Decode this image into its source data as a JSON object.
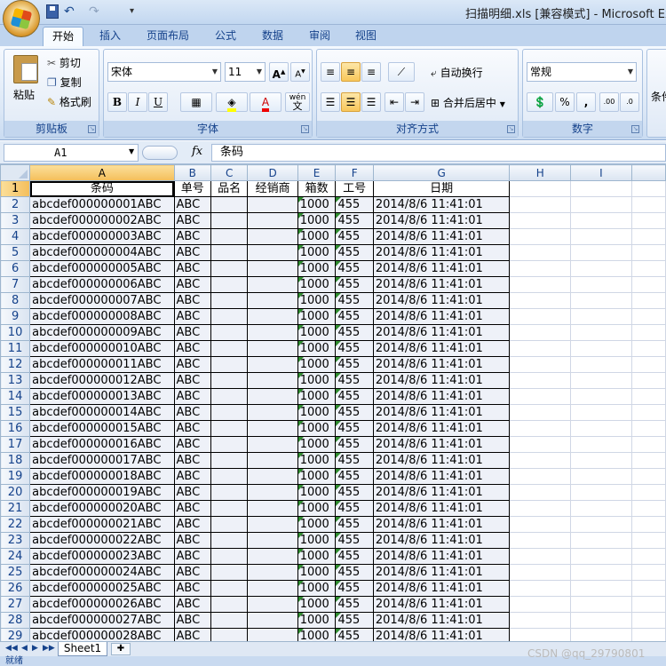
{
  "window": {
    "title": "扫描明细.xls [兼容模式] - Microsoft Exce"
  },
  "quick_access": {
    "undo": "↶",
    "redo": "↷",
    "more": "▾"
  },
  "ribbon": {
    "tabs": [
      "开始",
      "插入",
      "页面布局",
      "公式",
      "数据",
      "审阅",
      "视图"
    ],
    "clipboard": {
      "paste": "粘贴",
      "cut": "剪切",
      "copy": "复制",
      "format_painter": "格式刷",
      "label": "剪贴板"
    },
    "font": {
      "name": "宋体",
      "size": "11",
      "grow": "A",
      "shrink": "A",
      "bold": "B",
      "italic": "I",
      "underline": "U",
      "font_color": "A",
      "label": "字体",
      "wen": "wén",
      "wen_char": "文"
    },
    "alignment": {
      "wrap_text": "自动换行",
      "merge_center": "合并后居中",
      "label": "对齐方式"
    },
    "number": {
      "format": "常规",
      "percent": "%",
      "comma": ",",
      "label": "数字"
    },
    "styles": {
      "label": "条件"
    }
  },
  "formula_bar": {
    "name_box": "A1",
    "fx": "fx",
    "content": "条码"
  },
  "sheet": {
    "columns": [
      "A",
      "B",
      "C",
      "D",
      "E",
      "F",
      "G",
      "H",
      "I"
    ],
    "header_row": [
      "条码",
      "单号",
      "品名",
      "经销商",
      "箱数",
      "工号",
      "日期"
    ],
    "rows": [
      [
        "abcdef000000001ABC",
        "ABC",
        "",
        "",
        "1000",
        "455",
        "2014/8/6 11:41:01"
      ],
      [
        "abcdef000000002ABC",
        "ABC",
        "",
        "",
        "1000",
        "455",
        "2014/8/6 11:41:01"
      ],
      [
        "abcdef000000003ABC",
        "ABC",
        "",
        "",
        "1000",
        "455",
        "2014/8/6 11:41:01"
      ],
      [
        "abcdef000000004ABC",
        "ABC",
        "",
        "",
        "1000",
        "455",
        "2014/8/6 11:41:01"
      ],
      [
        "abcdef000000005ABC",
        "ABC",
        "",
        "",
        "1000",
        "455",
        "2014/8/6 11:41:01"
      ],
      [
        "abcdef000000006ABC",
        "ABC",
        "",
        "",
        "1000",
        "455",
        "2014/8/6 11:41:01"
      ],
      [
        "abcdef000000007ABC",
        "ABC",
        "",
        "",
        "1000",
        "455",
        "2014/8/6 11:41:01"
      ],
      [
        "abcdef000000008ABC",
        "ABC",
        "",
        "",
        "1000",
        "455",
        "2014/8/6 11:41:01"
      ],
      [
        "abcdef000000009ABC",
        "ABC",
        "",
        "",
        "1000",
        "455",
        "2014/8/6 11:41:01"
      ],
      [
        "abcdef000000010ABC",
        "ABC",
        "",
        "",
        "1000",
        "455",
        "2014/8/6 11:41:01"
      ],
      [
        "abcdef000000011ABC",
        "ABC",
        "",
        "",
        "1000",
        "455",
        "2014/8/6 11:41:01"
      ],
      [
        "abcdef000000012ABC",
        "ABC",
        "",
        "",
        "1000",
        "455",
        "2014/8/6 11:41:01"
      ],
      [
        "abcdef000000013ABC",
        "ABC",
        "",
        "",
        "1000",
        "455",
        "2014/8/6 11:41:01"
      ],
      [
        "abcdef000000014ABC",
        "ABC",
        "",
        "",
        "1000",
        "455",
        "2014/8/6 11:41:01"
      ],
      [
        "abcdef000000015ABC",
        "ABC",
        "",
        "",
        "1000",
        "455",
        "2014/8/6 11:41:01"
      ],
      [
        "abcdef000000016ABC",
        "ABC",
        "",
        "",
        "1000",
        "455",
        "2014/8/6 11:41:01"
      ],
      [
        "abcdef000000017ABC",
        "ABC",
        "",
        "",
        "1000",
        "455",
        "2014/8/6 11:41:01"
      ],
      [
        "abcdef000000018ABC",
        "ABC",
        "",
        "",
        "1000",
        "455",
        "2014/8/6 11:41:01"
      ],
      [
        "abcdef000000019ABC",
        "ABC",
        "",
        "",
        "1000",
        "455",
        "2014/8/6 11:41:01"
      ],
      [
        "abcdef000000020ABC",
        "ABC",
        "",
        "",
        "1000",
        "455",
        "2014/8/6 11:41:01"
      ],
      [
        "abcdef000000021ABC",
        "ABC",
        "",
        "",
        "1000",
        "455",
        "2014/8/6 11:41:01"
      ],
      [
        "abcdef000000022ABC",
        "ABC",
        "",
        "",
        "1000",
        "455",
        "2014/8/6 11:41:01"
      ],
      [
        "abcdef000000023ABC",
        "ABC",
        "",
        "",
        "1000",
        "455",
        "2014/8/6 11:41:01"
      ],
      [
        "abcdef000000024ABC",
        "ABC",
        "",
        "",
        "1000",
        "455",
        "2014/8/6 11:41:01"
      ],
      [
        "abcdef000000025ABC",
        "ABC",
        "",
        "",
        "1000",
        "455",
        "2014/8/6 11:41:01"
      ],
      [
        "abcdef000000026ABC",
        "ABC",
        "",
        "",
        "1000",
        "455",
        "2014/8/6 11:41:01"
      ],
      [
        "abcdef000000027ABC",
        "ABC",
        "",
        "",
        "1000",
        "455",
        "2014/8/6 11:41:01"
      ],
      [
        "abcdef000000028ABC",
        "ABC",
        "",
        "",
        "1000",
        "455",
        "2014/8/6 11:41:01"
      ]
    ],
    "sheet_tabs": [
      "Sheet1"
    ]
  },
  "status": {
    "text": "就绪"
  },
  "watermark": "CSDN @qq_29790801"
}
